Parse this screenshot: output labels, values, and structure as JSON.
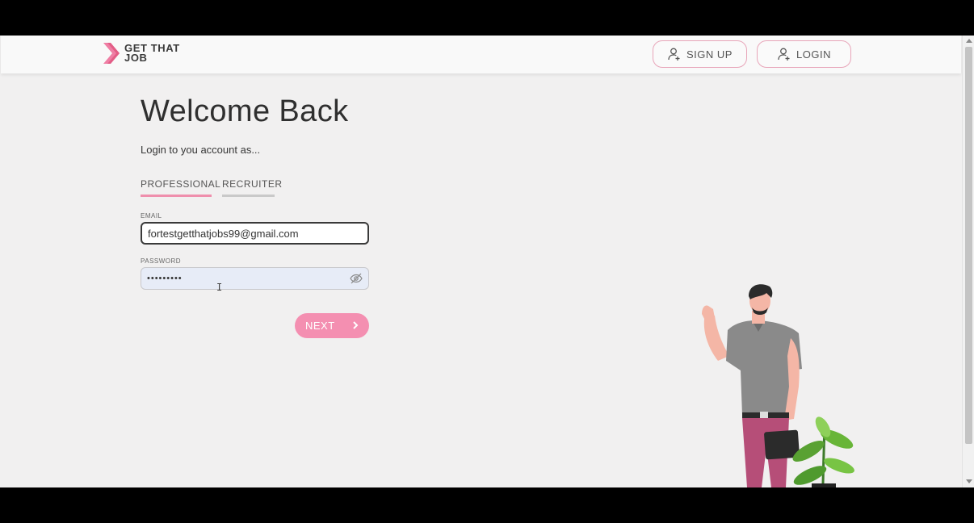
{
  "app": {
    "logo_text": "GET THAT JOB",
    "brand_color": "#f48fb1"
  },
  "header": {
    "signup_label": "SIGN UP",
    "login_label": "LOGIN",
    "signup_icon": "user-plus-icon",
    "login_icon": "user-plus-icon"
  },
  "main": {
    "title": "Welcome Back",
    "subtitle": "Login to you account as...",
    "tabs": [
      {
        "label": "PROFESSIONAL",
        "active": true
      },
      {
        "label": "RECRUITER",
        "active": false
      }
    ],
    "email": {
      "label": "EMAIL",
      "value": "fortestgetthatjobs99@gmail.com"
    },
    "password": {
      "label": "PASSWORD",
      "value": "•••••••••",
      "toggle_icon": "eye-off-icon"
    },
    "next_label": "NEXT",
    "next_icon": "chevron-right-icon"
  },
  "colors": {
    "accent": "#f48fb1",
    "tab_active_underline": "#ef8fad",
    "tab_inactive_underline": "#c9c9c9",
    "page_bg": "#f1f0f0"
  }
}
